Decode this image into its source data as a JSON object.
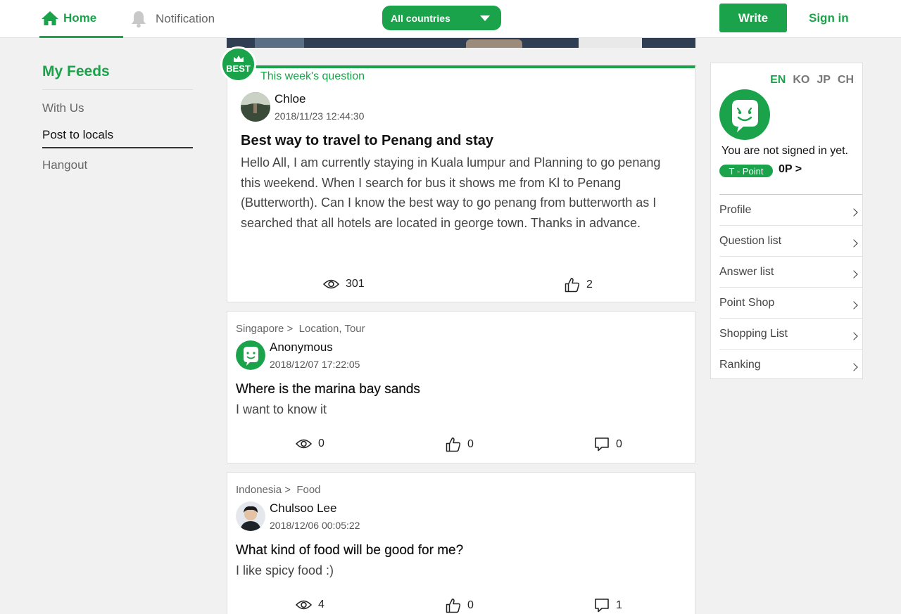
{
  "header": {
    "home_label": "Home",
    "notification_label": "Notification",
    "country_select": "All countries",
    "write_label": "Write",
    "signin_label": "Sign in"
  },
  "sidebar": {
    "title": "My Feeds",
    "items": [
      {
        "label": "With Us"
      },
      {
        "label": "Post to locals"
      },
      {
        "label": "Hangout"
      }
    ]
  },
  "best_question": {
    "badge": "BEST",
    "label": "This week's question",
    "author": "Chloe",
    "date": "2018/11/23 12:44:30",
    "title": "Best way to travel to Penang and stay",
    "body": "Hello All, I am currently staying in Kuala lumpur and Planning to go penang this weekend. When I search for bus it shows me from Kl to Penang (Butterworth). Can I know the best way to go penang from butterworth as I searched that all hotels are located in george town. Thanks in advance.",
    "views": "301",
    "likes": "2"
  },
  "posts": [
    {
      "country": "Singapore >",
      "category": "Location, Tour",
      "author": "Anonymous",
      "date": "2018/12/07 17:22:05",
      "title": "Where is the marina bay sands",
      "body": "I want to know it",
      "views": "0",
      "likes": "0",
      "comments": "0"
    },
    {
      "country": "Indonesia >",
      "category": "Food",
      "author": "Chulsoo Lee",
      "date": "2018/12/06 00:05:22",
      "title": "What kind of food will be good for me?",
      "body": "I like spicy food :)",
      "views": "4",
      "likes": "0",
      "comments": "1"
    }
  ],
  "user_panel": {
    "languages": [
      "EN",
      "KO",
      "JP",
      "CH"
    ],
    "active_language": "EN",
    "status": "You are not signed in yet.",
    "tpoint_label": "T - Point",
    "points": "0P >",
    "menu": [
      "Profile",
      "Question list",
      "Answer list",
      "Point Shop",
      "Shopping List",
      "Ranking"
    ]
  },
  "colors": {
    "brand_green": "#1aa34a",
    "background": "#f1f1f1"
  },
  "icons": [
    "home-icon",
    "bell-icon",
    "caret-down-icon",
    "crown-icon",
    "eye-icon",
    "thumbs-up-icon",
    "comment-icon",
    "chevron-right-icon",
    "smile-mascot-icon"
  ]
}
